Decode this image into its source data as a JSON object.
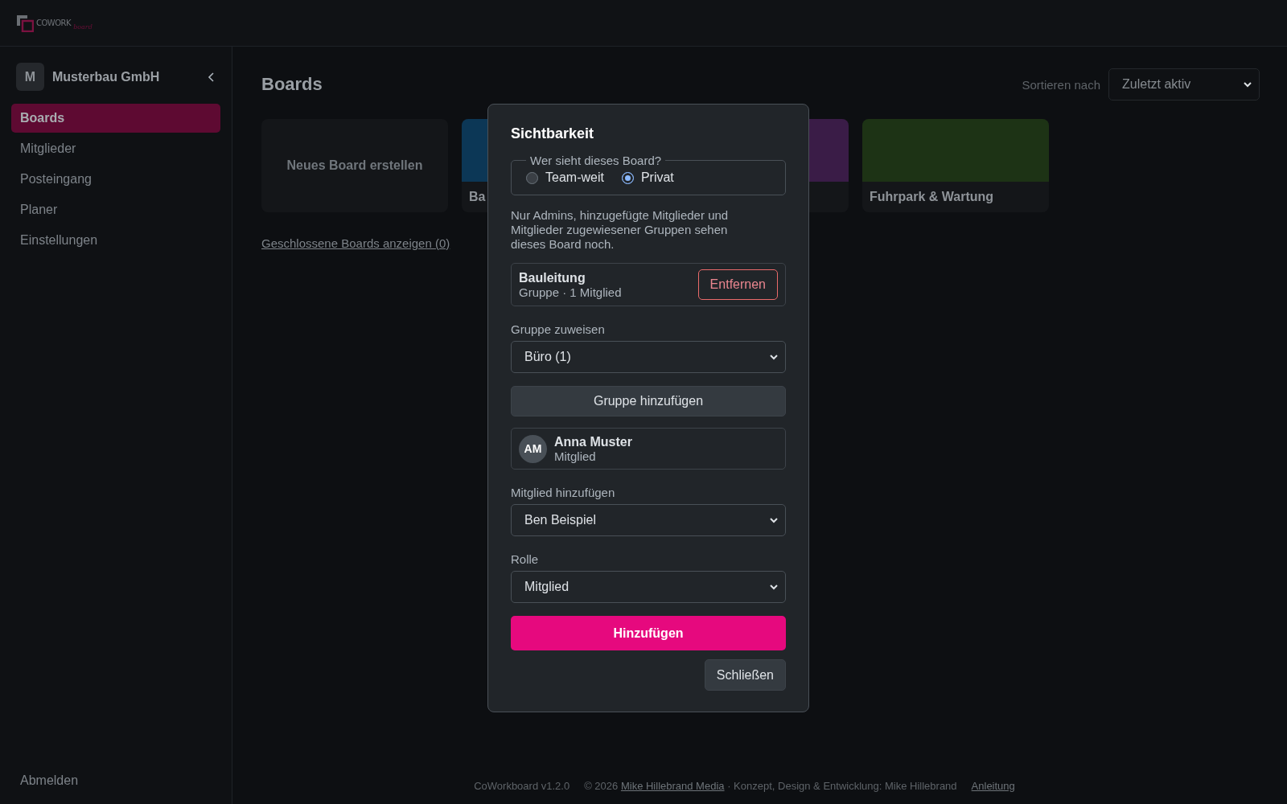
{
  "logo": {
    "word": "COWORK",
    "script": "board"
  },
  "sidebar": {
    "org": {
      "initial": "M",
      "name": "Musterbau GmbH"
    },
    "items": [
      {
        "label": "Boards",
        "selected": true
      },
      {
        "label": "Mitglieder",
        "selected": false
      },
      {
        "label": "Posteingang",
        "selected": false
      },
      {
        "label": "Planer",
        "selected": false
      },
      {
        "label": "Einstellungen",
        "selected": false
      }
    ],
    "logout": "Abmelden"
  },
  "main": {
    "title": "Boards",
    "sort": {
      "label": "Sortieren nach",
      "value": "Zuletzt aktiv"
    },
    "new_board": "Neues Board erstellen",
    "boards": [
      {
        "name": "Ba",
        "color": "#0c3756"
      },
      {
        "color": "#3a1c47"
      },
      {
        "name": "Fuhrpark & Wartung",
        "color": "#1d3315"
      }
    ],
    "closed_link": "Geschlossene Boards anzeigen (0)"
  },
  "dialog": {
    "title": "Sichtbarkeit",
    "visibility": {
      "legend": "Wer sieht dieses Board?",
      "options": [
        {
          "label": "Team-weit",
          "selected": false
        },
        {
          "label": "Privat",
          "selected": true
        }
      ]
    },
    "note": "Nur Admins, hinzugefügte Mitglieder und Mitglieder zugewiesener Gruppen sehen dieses Board noch.",
    "groups": [
      {
        "name": "Bauleitung",
        "meta": "Gruppe · 1 Mitglied",
        "action": "Entfernen"
      }
    ],
    "group_select": {
      "label": "Gruppe zuweisen",
      "value": "Büro (1)"
    },
    "add_group": "Gruppe hinzufügen",
    "members": [
      {
        "initials": "AM",
        "name": "Anna Muster",
        "role": "Mitglied"
      }
    ],
    "member_select": {
      "label": "Mitglied hinzufügen",
      "value": "Ben Beispiel"
    },
    "role_select": {
      "label": "Rolle",
      "value": "Mitglied"
    },
    "submit": "Hinzufügen",
    "close": "Schließen"
  },
  "footer": {
    "version": "CoWorkboard v1.2.0",
    "copyright": "© 2026",
    "link": "Mike Hillebrand Media",
    "credit": "· Konzept, Design & Entwicklung: Mike Hillebrand",
    "help": "Anleitung"
  }
}
